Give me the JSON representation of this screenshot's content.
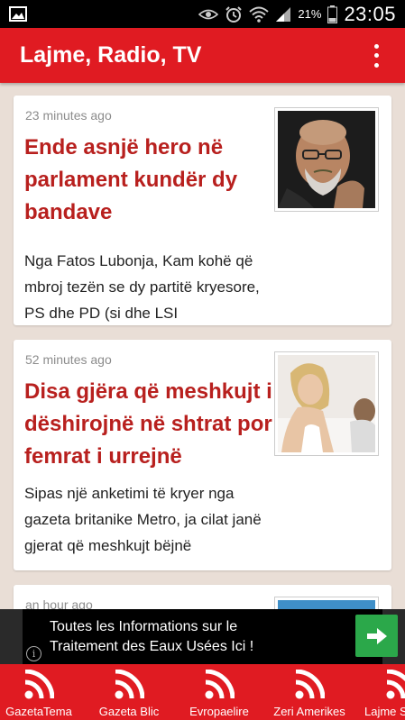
{
  "status_bar": {
    "battery": "21%",
    "time": "23:05"
  },
  "app_bar": {
    "title": "Lajme, Radio, TV"
  },
  "articles": [
    {
      "time": "23 minutes ago",
      "title": "Ende asnjë hero në parlament kundër dy bandave",
      "excerpt": "Nga Fatos Lubonja, Kam kohë që mbroj tezën se dy partitë kryesore, PS dhe PD (si dhe LSI"
    },
    {
      "time": "52 minutes ago",
      "title": "Disa gjëra që meshkujt i dëshirojnë në shtrat por femrat i urrejnë",
      "excerpt": "Sipas një anketimi të kryer nga gazeta britanike Metro, ja cilat janë gjerat që meshkujt bëjnë"
    },
    {
      "time": "an hour ago"
    }
  ],
  "ad": {
    "line1": "Toutes les Informations sur le",
    "line2": "Traitement des Eaux Usées Ici !",
    "info": "i"
  },
  "bottom_nav": [
    {
      "label": "GazetaTema"
    },
    {
      "label": "Gazeta Blic"
    },
    {
      "label": "Evropaelire"
    },
    {
      "label": "Zeri Amerikes"
    },
    {
      "label": "Lajme Shqip"
    }
  ],
  "colors": {
    "accent": "#e01b22",
    "headline": "#b8201e",
    "background": "#e9ded6",
    "ad_button": "#2ba84a"
  },
  "icons": {
    "status": [
      "gallery-icon",
      "eye-icon",
      "alarm-icon",
      "wifi-icon",
      "signal-icon",
      "battery-icon"
    ],
    "overflow": "overflow-menu-icon",
    "nav": "rss-icon",
    "ad": "arrow-right-icon"
  }
}
